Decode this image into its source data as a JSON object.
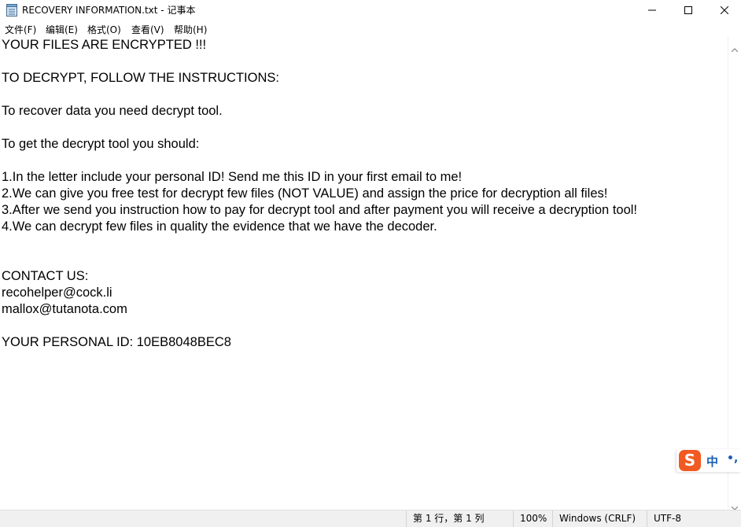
{
  "window": {
    "title": "RECOVERY INFORMATION.txt - 记事本"
  },
  "menu": [
    "文件(F)",
    "编辑(E)",
    "格式(O)",
    "查看(V)",
    "帮助(H)"
  ],
  "document": {
    "lines": [
      "YOUR FILES ARE ENCRYPTED !!!",
      "",
      "TO DECRYPT, FOLLOW THE INSTRUCTIONS:",
      "",
      "To recover data you need decrypt tool.",
      "",
      "To get the decrypt tool you should:",
      "",
      "1.In the letter include your personal ID! Send me this ID in your first email to me!",
      "2.We can give you free test for decrypt few files (NOT VALUE) and assign the price for decryption all files!",
      "3.After we send you instruction how to pay for decrypt tool and after payment you will receive a decryption tool!",
      "4.We can decrypt few files in quality the evidence that we have the decoder.",
      "",
      "",
      "CONTACT US:",
      "recohelper@cock.li",
      "mallox@tutanota.com",
      "",
      "YOUR PERSONAL ID: 10EB8048BEC8"
    ]
  },
  "statusbar": {
    "position": "第 1 行，第 1 列",
    "zoom": "100%",
    "line_ending": "Windows (CRLF)",
    "encoding": "UTF-8"
  },
  "ime": {
    "logo": "S",
    "mode": "中",
    "punct": "•,"
  },
  "colors": {
    "ime_logo": "#f15a22",
    "ime_text": "#1a5fb4",
    "statusbar_bg": "#f0f0f0"
  }
}
